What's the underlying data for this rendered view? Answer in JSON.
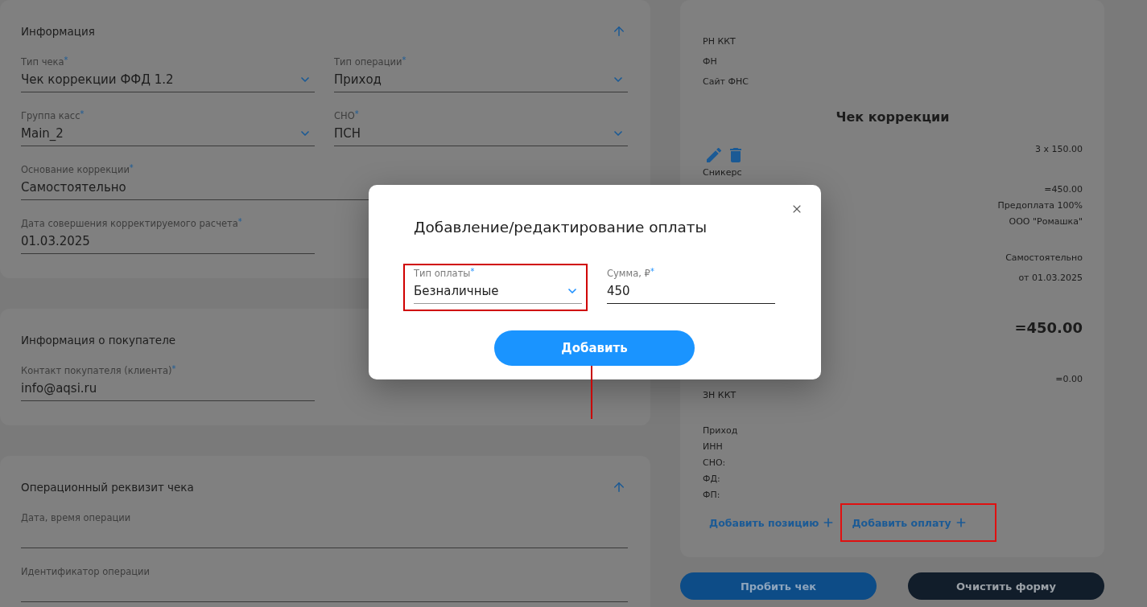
{
  "form_sections": [
    {
      "title": "Информация",
      "expanded": true,
      "rows": [
        {
          "fields": [
            {
              "kind": "select",
              "label": "Тип чека$^{*}$",
              "value": "Чек коррекции ФФД 1.2",
              "wide": false
            },
            {
              "kind": "select",
              "label": "Тип операции$^{*}$",
              "value": "Приход",
              "wide": false
            }
          ]
        },
        {
          "fields": [
            {
              "kind": "select",
              "label": "Группа касс$^{*}$",
              "value": "Main_2",
              "wide": false
            },
            {
              "kind": "select",
              "label": "СНО$^{*}$",
              "value": "ПСН",
              "wide": false
            }
          ]
        },
        {
          "fields": [
            {
              "kind": "text",
              "label": "Основание коррекции$^{*}$",
              "value": "Самостоятельно",
              "wide": true
            }
          ]
        },
        {
          "fields": [
            {
              "kind": "text",
              "label": "Дата совершения корректируемого расчета$^{*}$",
              "value": "01.03.2025",
              "wide": false
            }
          ]
        }
      ]
    },
    {
      "title": "Информация о покупателе",
      "rows": [
        {
          "fields": [
            {
              "kind": "text",
              "label": "Контакт покупателя (клиента)$^{*}$",
              "value": "info@aqsi.ru",
              "wide": false
            }
          ]
        }
      ]
    },
    {
      "title": "Операционный реквизит чека",
      "expanded": true,
      "rows": [
        {
          "fields": [
            {
              "kind": "text",
              "label": "Дата, время операции",
              "wide": true
            }
          ]
        },
        {
          "fields": [
            {
              "kind": "text",
              "label": "Идентификатор операции",
              "wide": true
            }
          ]
        }
      ]
    }
  ],
  "receipt": {
    "registry": [
      "РН ККТ",
      "ФН",
      "Сайт ФНС"
    ],
    "title": "Чек коррекции",
    "item": {
      "amount": "3 x 150.00",
      "name": "Сникерс"
    },
    "item_details": [
      "=450.00",
      "Предоплата 100%",
      "ООО \"Ромашка\""
    ],
    "correction": [
      "Самостоятельно",
      "от 01.03.2025"
    ],
    "total": "=450.00",
    "summary_rows": [
      {
        "value": "=0.00"
      },
      {
        "label": "ЗН ККТ"
      }
    ],
    "fiscal": [
      "Приход",
      "ИНН",
      "СНО:",
      "ФД:",
      "ФП:"
    ],
    "actions": [
      {
        "label": "Добавить позицию",
        "highlighted": false
      },
      {
        "label": "Добавить оплату",
        "highlighted": true
      }
    ]
  },
  "footer_buttons": [
    {
      "kind": "primary",
      "label": "Пробить чек"
    },
    {
      "kind": "dark",
      "label": "Очистить форму"
    }
  ],
  "modal": {
    "title": "Добавление/редактирование оплаты",
    "fields": [
      {
        "kind": "select",
        "label": "Тип оплаты$^{*}$",
        "value": "Безналичные",
        "highlighted": true,
        "focused": false
      },
      {
        "kind": "text",
        "label": "Сумма, ₽$^{*}$",
        "value": "450",
        "highlighted": false,
        "focused": true
      }
    ],
    "submit": {
      "label": "Добавить",
      "marked": true
    }
  }
}
